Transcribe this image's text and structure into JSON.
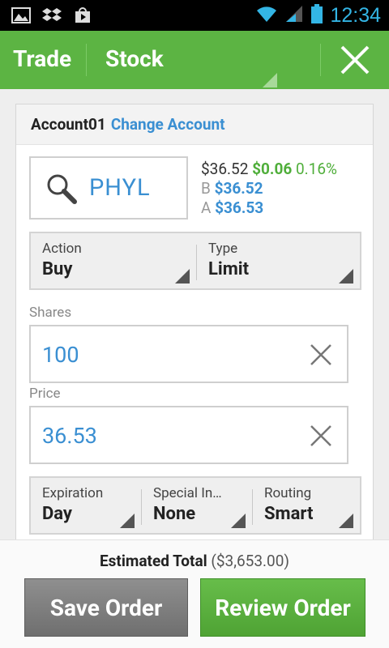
{
  "status_bar": {
    "time": "12:34",
    "icons": [
      "gallery-icon",
      "dropbox-icon",
      "play-store-icon",
      "wifi-icon",
      "signal-icon",
      "battery-icon"
    ]
  },
  "action_bar": {
    "section": "Trade",
    "instrument": "Stock",
    "close_icon": "close-icon"
  },
  "account": {
    "name": "Account01",
    "change_label": "Change Account"
  },
  "symbol": {
    "search_icon": "search-icon",
    "ticker": "PHYL"
  },
  "quote": {
    "last": "$36.52",
    "change": "$0.06",
    "change_pct": "0.16%",
    "bid_label": "B",
    "bid": "$36.52",
    "ask_label": "A",
    "ask": "$36.53"
  },
  "order_type": {
    "action_label": "Action",
    "action_value": "Buy",
    "type_label": "Type",
    "type_value": "Limit"
  },
  "shares": {
    "label": "Shares",
    "value": "100"
  },
  "price": {
    "label": "Price",
    "value": "36.53"
  },
  "options": {
    "expiration_label": "Expiration",
    "expiration_value": "Day",
    "special_label": "Special In…",
    "special_value": "None",
    "routing_label": "Routing",
    "routing_value": "Smart"
  },
  "footer": {
    "estimated_label": "Estimated Total",
    "estimated_value": "($3,653.00)",
    "save_label": "Save Order",
    "review_label": "Review Order"
  },
  "colors": {
    "brand_green": "#5cb443",
    "link_blue": "#3a8fd2",
    "gain_green": "#4fae3a",
    "status_blue": "#33b5e5"
  }
}
